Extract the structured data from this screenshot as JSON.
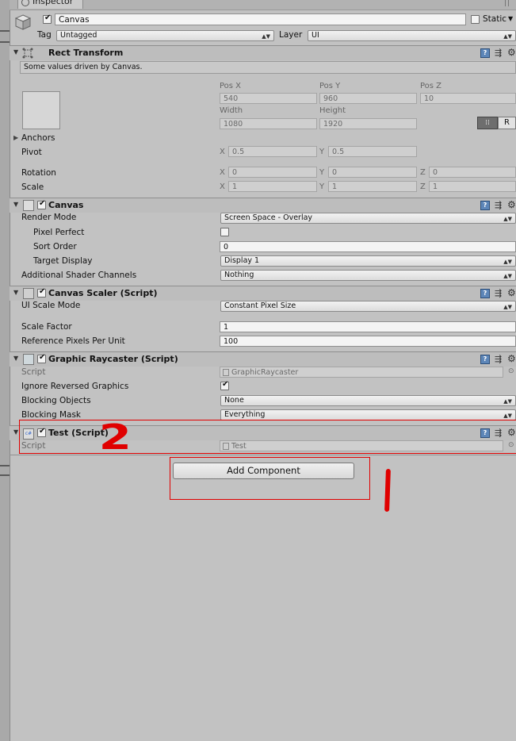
{
  "window": {
    "tab_label": "Inspector"
  },
  "object": {
    "name": "Canvas",
    "static_label": "Static",
    "tag_label": "Tag",
    "tag_value": "Untagged",
    "layer_label": "Layer",
    "layer_value": "UI"
  },
  "rect_transform": {
    "title": "Rect Transform",
    "note": "Some values driven by Canvas.",
    "pos_x_label": "Pos X",
    "pos_y_label": "Pos Y",
    "pos_z_label": "Pos Z",
    "pos_x": "540",
    "pos_y": "960",
    "pos_z": "10",
    "width_label": "Width",
    "height_label": "Height",
    "width": "1080",
    "height": "1920",
    "anchors_label": "Anchors",
    "pivot_label": "Pivot",
    "pivot_x": "0.5",
    "pivot_y": "0.5",
    "rotation_label": "Rotation",
    "rot_x": "0",
    "rot_y": "0",
    "rot_z": "0",
    "scale_label": "Scale",
    "scale_x": "1",
    "scale_y": "1",
    "scale_z": "1",
    "x": "X",
    "y": "Y",
    "z": "Z",
    "r_button": "R"
  },
  "canvas": {
    "title": "Canvas",
    "render_mode_label": "Render Mode",
    "render_mode": "Screen Space - Overlay",
    "pixel_perfect_label": "Pixel Perfect",
    "sort_order_label": "Sort Order",
    "sort_order": "0",
    "target_display_label": "Target Display",
    "target_display": "Display 1",
    "shader_channels_label": "Additional Shader Channels",
    "shader_channels": "Nothing"
  },
  "canvas_scaler": {
    "title": "Canvas Scaler (Script)",
    "ui_scale_mode_label": "UI Scale Mode",
    "ui_scale_mode": "Constant Pixel Size",
    "scale_factor_label": "Scale Factor",
    "scale_factor": "1",
    "ref_ppu_label": "Reference Pixels Per Unit",
    "ref_ppu": "100"
  },
  "graphic_raycaster": {
    "title": "Graphic Raycaster (Script)",
    "script_label": "Script",
    "script_value": "GraphicRaycaster",
    "ignore_reversed_label": "Ignore Reversed Graphics",
    "blocking_objects_label": "Blocking Objects",
    "blocking_objects": "None",
    "blocking_mask_label": "Blocking Mask",
    "blocking_mask": "Everything"
  },
  "test": {
    "title": "Test (Script)",
    "script_label": "Script",
    "script_value": "Test"
  },
  "add_component_label": "Add Component",
  "annotations": {
    "one": "1",
    "two": "2",
    "color": "#e00000"
  }
}
